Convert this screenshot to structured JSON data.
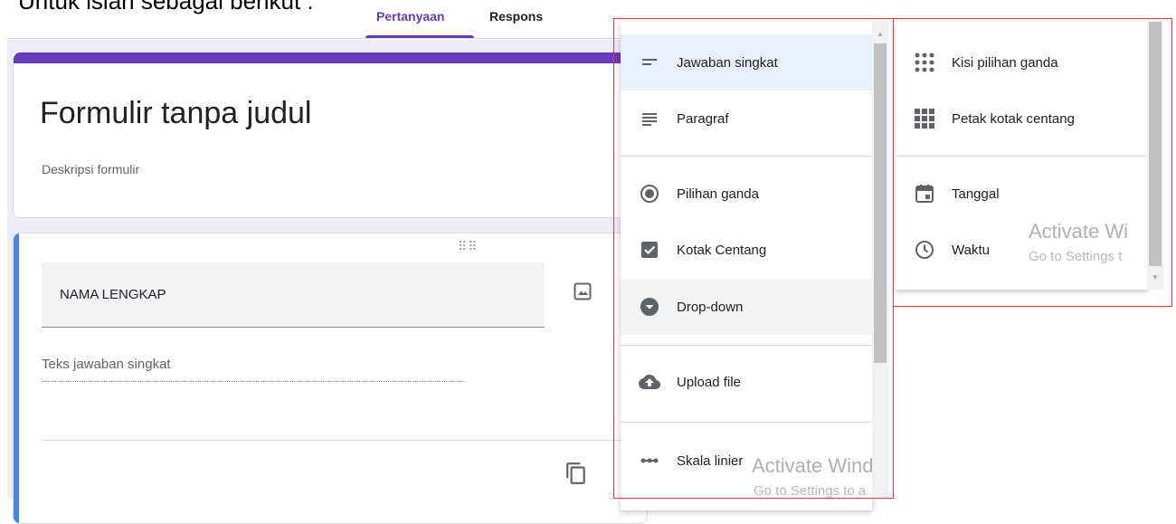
{
  "caption": "Untuk isian sebagai berikut :",
  "tabs": [
    "Pertanyaan",
    "Respons"
  ],
  "form": {
    "title": "Formulir tanpa judul",
    "description": "Deskripsi formulir"
  },
  "question": {
    "title_value": "NAMA LENGKAP",
    "answer_hint": "Teks jawaban singkat"
  },
  "type_menu_left": [
    {
      "label": "Jawaban singkat",
      "icon": "short-answer-icon",
      "state": "selected"
    },
    {
      "label": "Paragraf",
      "icon": "paragraph-icon"
    },
    {
      "label": "Pilihan ganda",
      "icon": "radio-icon"
    },
    {
      "label": "Kotak Centang",
      "icon": "checkbox-icon"
    },
    {
      "label": "Drop-down",
      "icon": "dropdown-icon",
      "state": "hovered"
    },
    {
      "label": "Upload file",
      "icon": "cloud-upload-icon"
    },
    {
      "label": "Skala linier",
      "icon": "linear-scale-icon"
    }
  ],
  "type_menu_right": [
    {
      "label": "Kisi pilihan ganda",
      "icon": "grid-radio-icon"
    },
    {
      "label": "Petak kotak centang",
      "icon": "grid-checkbox-icon"
    },
    {
      "label": "Tanggal",
      "icon": "calendar-icon"
    },
    {
      "label": "Waktu",
      "icon": "clock-icon"
    }
  ],
  "watermark": {
    "title_left": "Activate Wind",
    "sub_left": "Go to Settings to a",
    "title_right": "Activate Wi",
    "sub_right": "Go to Settings t"
  },
  "colors": {
    "accent": "#673ab7",
    "question_bar": "#4285f4",
    "highlight_box": "#e53935",
    "selected_bg": "#e8f0fe"
  }
}
